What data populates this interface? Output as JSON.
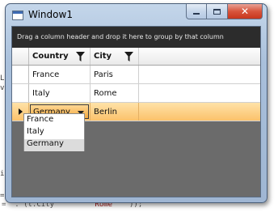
{
  "background": {
    "code_fragments": [
      "L",
      "v",
      "i",
      "="
    ],
    "bottom_line_prefix": "= \". (t.City",
    "bottom_line_string": "\"Rome\"",
    "bottom_line_suffix": "));"
  },
  "window": {
    "title": "Window1",
    "icon": "window-app-icon",
    "buttons": {
      "minimize_icon": "minimize-icon",
      "maximize_icon": "maximize-icon",
      "close_glyph": "✕"
    }
  },
  "group_panel": {
    "text": "Drag a column header and drop it here to group by that column"
  },
  "grid": {
    "columns": [
      {
        "label": "Country",
        "filter_icon": "filter-icon"
      },
      {
        "label": "City",
        "filter_icon": "filter-icon"
      }
    ],
    "rows": [
      {
        "country": "France",
        "city": "Paris"
      },
      {
        "country": "Italy",
        "city": "Rome"
      },
      {
        "country": "Germany",
        "city": "Berlin"
      }
    ],
    "selected_row_index": 2,
    "row_indicator_icon": "current-row-arrow-icon"
  },
  "country_editor": {
    "value": "Germany",
    "options": [
      "France",
      "Italy",
      "Germany"
    ],
    "highlighted_option": "Germany"
  },
  "colors": {
    "group_panel_bg": "#2c2c2c",
    "grid_empty_bg": "#6b6b6b",
    "selected_row": "#fbc26b",
    "close_button": "#d8553c"
  }
}
